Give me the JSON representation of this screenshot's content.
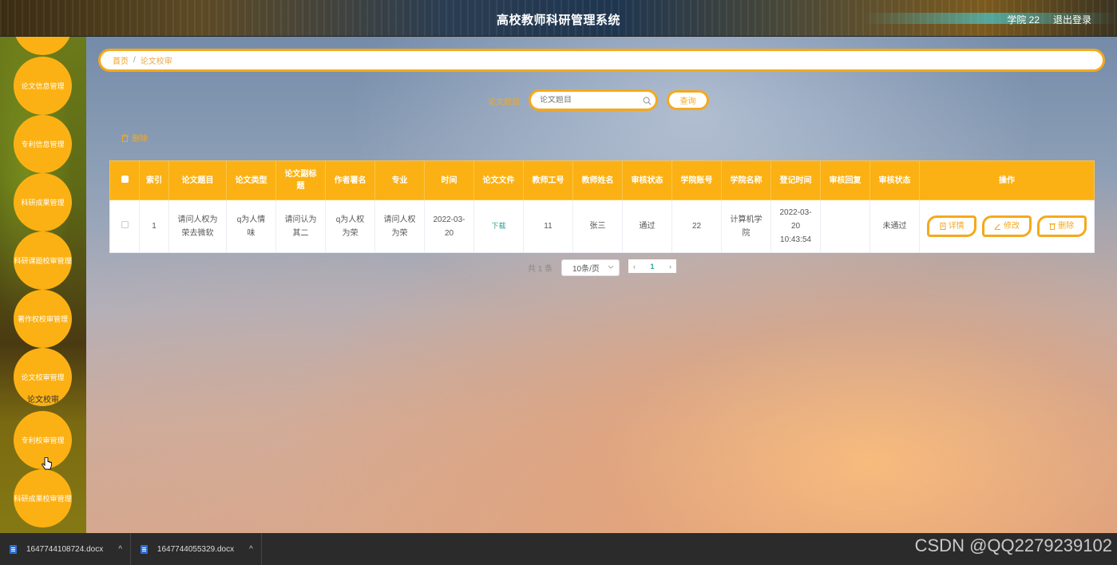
{
  "app": {
    "title": "高校教师科研管理系统",
    "user": "学院 22",
    "logout": "退出登录"
  },
  "sidebar": {
    "items": [
      {
        "label": ""
      },
      {
        "label": "论文信息管理"
      },
      {
        "label": "专利信息管理"
      },
      {
        "label": "科研成果管理"
      },
      {
        "label": "科研课题校审管理"
      },
      {
        "label": "著作权校审管理"
      },
      {
        "label": "论文校审管理"
      },
      {
        "label": "专利校审管理"
      },
      {
        "label": "科研成果校审管理"
      }
    ],
    "active_sub": "论文校审"
  },
  "breadcrumb": {
    "home": "首页",
    "separator": "/",
    "current": "论文校审"
  },
  "search": {
    "label": "论文题目",
    "placeholder": "论文题目",
    "button": "查询"
  },
  "toolbar": {
    "delete_label": "删除"
  },
  "table": {
    "headers": [
      "索引",
      "论文题目",
      "论文类型",
      "论文副标题",
      "作者署名",
      "专业",
      "时间",
      "论文文件",
      "教师工号",
      "教师姓名",
      "审核状态",
      "学院账号",
      "学院名称",
      "登记时间",
      "审核回复",
      "审核状态",
      "操作"
    ],
    "rows": [
      {
        "index": "1",
        "title": "请问人权为荣去微软",
        "type": "q为人情味",
        "subtitle": "请问认为其二",
        "author": "q为人权为荣",
        "major": "请问人权为荣",
        "time": "2022-03-20",
        "file": "下载",
        "teacher_id": "11",
        "teacher_name": "张三",
        "status": "通过",
        "college_account": "22",
        "college_name": "计算机学院",
        "register_time": "2022-03-20 10:43:54",
        "reply": "",
        "review_status": "未通过"
      }
    ],
    "actions": {
      "detail": "详情",
      "edit": "修改",
      "delete": "删除"
    }
  },
  "pagination": {
    "total": "共 1 条",
    "page_size": "10条/页",
    "current_page": "1"
  },
  "taskbar": {
    "downloads": [
      "1647744108724.docx",
      "1647744055329.docx"
    ],
    "watermark": "CSDN @QQ2279239102"
  },
  "colors": {
    "accent": "#fbb114",
    "link": "#2aa19a"
  }
}
